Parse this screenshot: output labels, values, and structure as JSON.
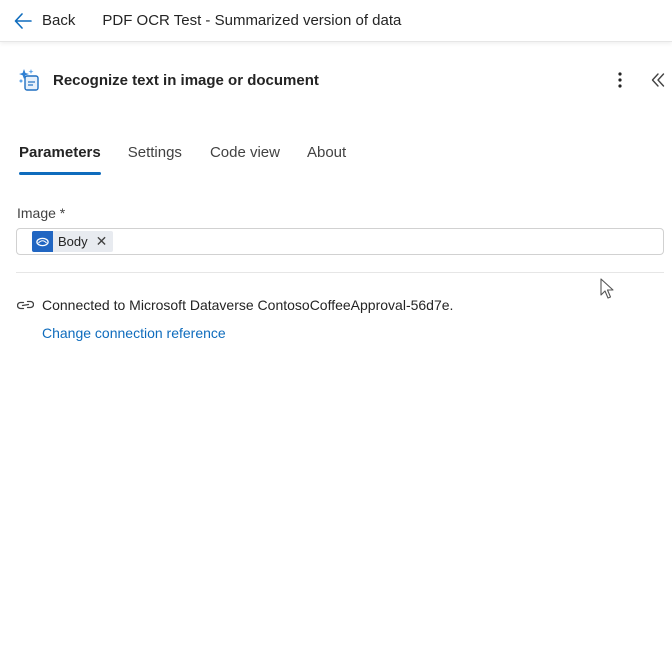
{
  "topbar": {
    "back_label": "Back",
    "flow_title": "PDF OCR Test - Summarized version of data"
  },
  "action": {
    "title": "Recognize text in image or document",
    "icon": "ai-document-sparkle-icon"
  },
  "tabs": [
    {
      "label": "Parameters",
      "active": true
    },
    {
      "label": "Settings",
      "active": false
    },
    {
      "label": "Code view",
      "active": false
    },
    {
      "label": "About",
      "active": false
    }
  ],
  "fields": {
    "image": {
      "label": "Image *",
      "token": {
        "label": "Body",
        "icon": "dataverse-icon"
      }
    }
  },
  "connection": {
    "text": "Connected to Microsoft Dataverse ContosoCoffeeApproval-56d7e.",
    "change_link": "Change connection reference"
  },
  "colors": {
    "accent": "#0f6cbd",
    "token_icon_bg": "#2166c2",
    "token_bg": "#e8ebf0"
  }
}
